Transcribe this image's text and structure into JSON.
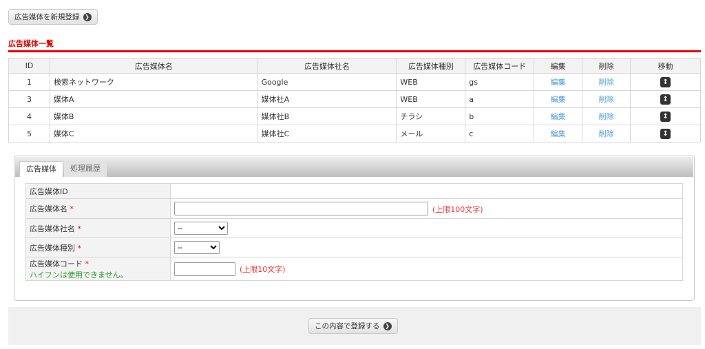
{
  "top_button": "広告媒体を新規登録",
  "section_title": "広告媒体一覧",
  "list": {
    "headers": [
      "ID",
      "広告媒体名",
      "広告媒体社名",
      "広告媒体種別",
      "広告媒体コード",
      "編集",
      "削除",
      "移動"
    ],
    "rows": [
      {
        "id": "1",
        "name": "検索ネットワーク",
        "company": "Google",
        "type": "WEB",
        "code": "gs",
        "edit": "編集",
        "delete": "削除"
      },
      {
        "id": "3",
        "name": "媒体A",
        "company": "媒体社A",
        "type": "WEB",
        "code": "a",
        "edit": "編集",
        "delete": "削除"
      },
      {
        "id": "4",
        "name": "媒体B",
        "company": "媒体社B",
        "type": "チラシ",
        "code": "b",
        "edit": "編集",
        "delete": "削除"
      },
      {
        "id": "5",
        "name": "媒体C",
        "company": "媒体社C",
        "type": "メール",
        "code": "c",
        "edit": "編集",
        "delete": "削除"
      }
    ]
  },
  "tabs": [
    "広告媒体",
    "処理履歴"
  ],
  "form": {
    "id_label": "広告媒体ID",
    "name_label": "広告媒体名",
    "name_limit": "(上限100文字)",
    "company_label": "広告媒体社名",
    "company_value": "--",
    "type_label": "広告媒体種別",
    "type_value": "--",
    "code_label": "広告媒体コード",
    "code_hint": "ハイフンは使用できません。",
    "code_limit": "(上限10文字)",
    "required_mark": "*"
  },
  "submit_button": "この内容で登録する"
}
